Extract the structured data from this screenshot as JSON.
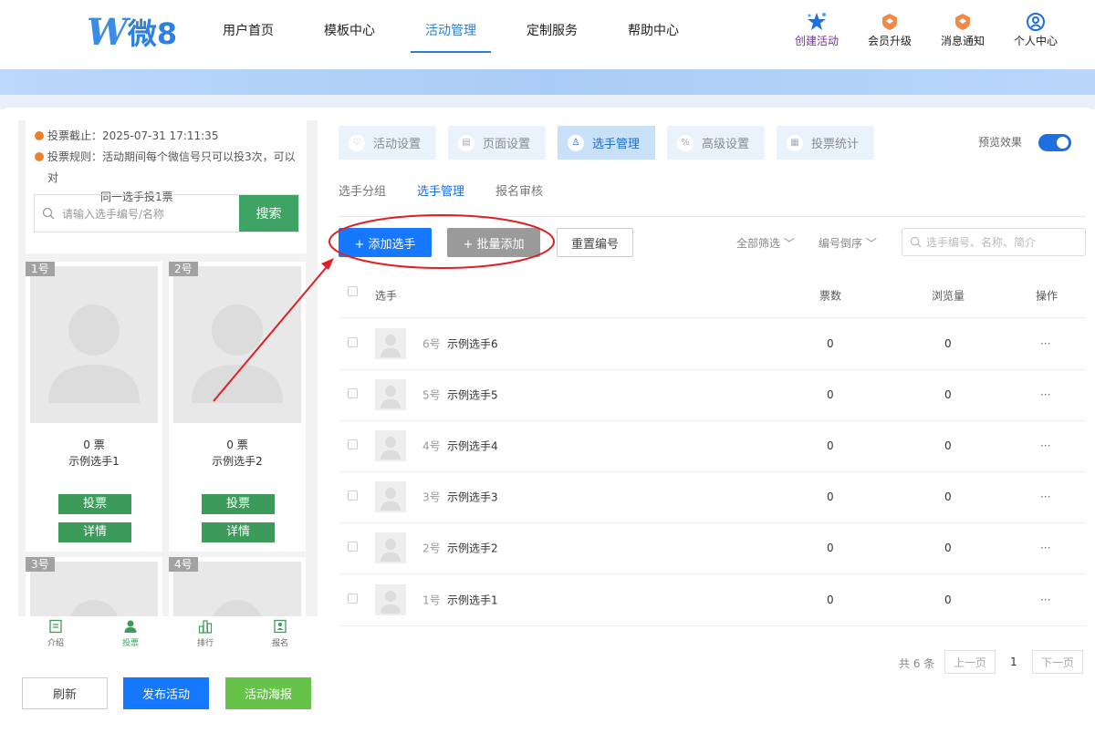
{
  "header": {
    "logo_text": "微8",
    "nav": [
      "用户首页",
      "模板中心",
      "活动管理",
      "定制服务",
      "帮助中心"
    ],
    "actions": [
      {
        "label": "创建活动",
        "icon": "stars-icon"
      },
      {
        "label": "会员升级",
        "icon": "badge-icon"
      },
      {
        "label": "消息通知",
        "icon": "bell-badge-icon"
      },
      {
        "label": "个人中心",
        "icon": "user-circle-icon"
      }
    ]
  },
  "preview": {
    "deadline": "投票截止：2025-07-31 17:11:35",
    "rule_line1": "投票规则：活动期间每个微信号只可以投3次，可以对",
    "rule_line2": "同一选手投1票",
    "search_placeholder": "请输入选手编号/名称",
    "search_button": "搜索",
    "cards": [
      {
        "num": "1号",
        "votes": "0 票",
        "name": "示例选手1"
      },
      {
        "num": "2号",
        "votes": "0 票",
        "name": "示例选手2"
      },
      {
        "num": "3号"
      },
      {
        "num": "4号"
      }
    ],
    "vote_label": "投票",
    "detail_label": "详情",
    "tabs": [
      "介绍",
      "投票",
      "排行",
      "报名"
    ],
    "buttons": {
      "refresh": "刷新",
      "publish": "发布活动",
      "poster": "活动海报"
    }
  },
  "settings_tabs": [
    "活动设置",
    "页面设置",
    "选手管理",
    "高级设置",
    "投票统计"
  ],
  "preview_label": "预览效果",
  "subtabs": [
    "选手分组",
    "选手管理",
    "报名审核"
  ],
  "toolbar": {
    "add": "+ 添加选手",
    "batch": "+ 批量添加",
    "reset": "重置编号",
    "filter_all": "全部筛选",
    "sort": "编号倒序",
    "search_placeholder": "选手编号、名称、简介"
  },
  "table": {
    "headers": [
      "选手",
      "票数",
      "浏览量",
      "操作"
    ],
    "rows": [
      {
        "num": "6号",
        "name": "示例选手6",
        "votes": "0",
        "views": "0",
        "ops": "···"
      },
      {
        "num": "5号",
        "name": "示例选手5",
        "votes": "0",
        "views": "0",
        "ops": "···"
      },
      {
        "num": "4号",
        "name": "示例选手4",
        "votes": "0",
        "views": "0",
        "ops": "···"
      },
      {
        "num": "3号",
        "name": "示例选手3",
        "votes": "0",
        "views": "0",
        "ops": "···"
      },
      {
        "num": "2号",
        "name": "示例选手2",
        "votes": "0",
        "views": "0",
        "ops": "···"
      },
      {
        "num": "1号",
        "name": "示例选手1",
        "votes": "0",
        "views": "0",
        "ops": "···"
      }
    ]
  },
  "pagination": {
    "total": "共 6 条",
    "prev": "上一页",
    "page": "1",
    "next": "下一页"
  },
  "colors": {
    "brand": "#1e6fe0",
    "green": "#3c9a5b",
    "annotation_red": "#e02020"
  }
}
